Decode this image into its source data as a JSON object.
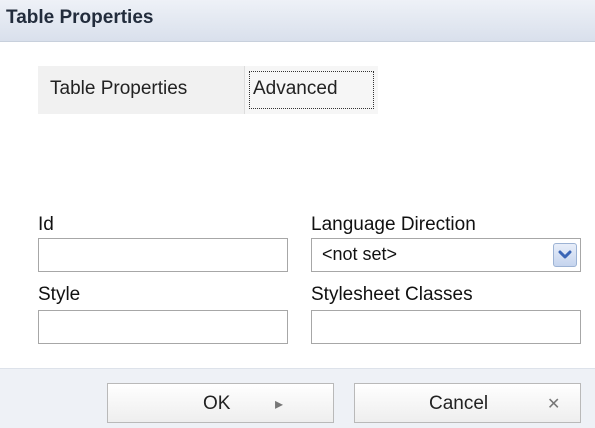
{
  "dialog": {
    "title": "Table Properties"
  },
  "tabs": [
    {
      "label": "Table Properties"
    },
    {
      "label": "Advanced"
    }
  ],
  "fields": {
    "id_label": "Id",
    "id_value": "",
    "language_direction_label": "Language Direction",
    "language_direction_value": "<not set>",
    "style_label": "Style",
    "style_value": "",
    "stylesheet_classes_label": "Stylesheet Classes",
    "stylesheet_classes_value": ""
  },
  "buttons": {
    "ok_label": "OK",
    "ok_icon": "play-icon",
    "cancel_label": "Cancel",
    "cancel_icon": "close-icon"
  },
  "colors": {
    "titlebar": "#d9e0ec",
    "footer": "#eef1f6",
    "select_arrow": "#3a65b6"
  }
}
